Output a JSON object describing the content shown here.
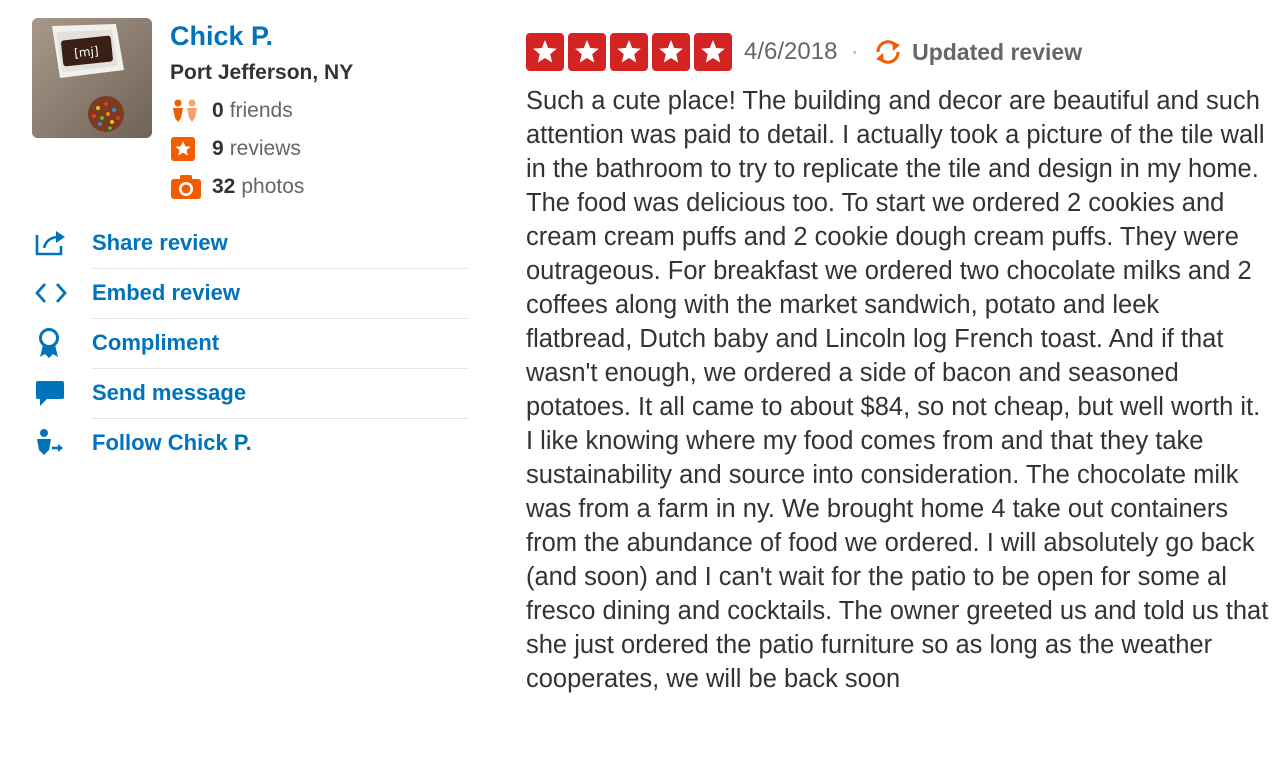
{
  "user": {
    "name": "Chick P.",
    "location": "Port Jefferson, NY",
    "friends_count": "0",
    "friends_label": "friends",
    "reviews_count": "9",
    "reviews_label": "reviews",
    "photos_count": "32",
    "photos_label": "photos",
    "avatar_icon": "dessert-photo"
  },
  "actions": [
    {
      "label": "Share review",
      "icon": "share-icon"
    },
    {
      "label": "Embed review",
      "icon": "embed-icon"
    },
    {
      "label": "Compliment",
      "icon": "award-icon"
    },
    {
      "label": "Send message",
      "icon": "message-icon"
    },
    {
      "label": "Follow Chick P.",
      "icon": "follow-icon"
    }
  ],
  "review": {
    "rating": 5,
    "rating_max": 5,
    "date": "4/6/2018",
    "separator": "·",
    "updated_label": "Updated review",
    "text": "Such a cute place! The building and decor are beautiful and such attention was paid to detail. I actually took a picture of the tile wall in the bathroom to try to replicate the tile and design in my home. The food was delicious too. To start we ordered 2 cookies and cream cream puffs and 2 cookie dough cream puffs. They were outrageous. For breakfast we ordered two chocolate milks and 2 coffees along with the market sandwich, potato and leek flatbread, Dutch baby and Lincoln log French toast. And if that wasn't enough, we ordered a side of bacon and seasoned potatoes. It all came to about $84, so not cheap, but well worth it. I like knowing where my food comes from and that they take sustainability and source into consideration. The chocolate milk was from a farm in ny. We brought home 4 take out containers from the abundance of food we ordered. I will absolutely go back (and soon) and I can't wait for the patio to be open for some al fresco dining and cocktails. The owner greeted us and told us that she just ordered the patio furniture so as long as the weather cooperates, we will be back soon"
  },
  "colors": {
    "link_blue": "#0073bb",
    "star_red": "#d32323",
    "orange": "#f15c00",
    "friends_orange": "#f6904a",
    "text_dark": "#333333",
    "text_gray": "#666666",
    "divider": "#e6e6e6"
  }
}
